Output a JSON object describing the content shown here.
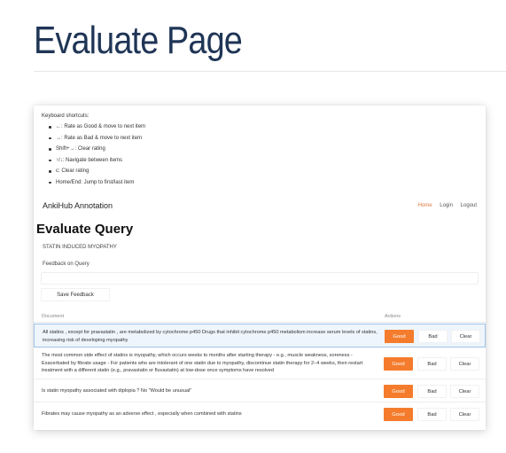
{
  "slide": {
    "title": "Evaluate Page"
  },
  "shortcuts": {
    "title": "Keyboard shortcuts:",
    "items": [
      "←: Rate as Good & move to next item",
      "→: Rate as Bad & move to next item",
      "Shift+→: Clear rating",
      "↑/↓: Navigate between items",
      "c: Clear rating",
      "Home/End: Jump to first/last item"
    ]
  },
  "nav": {
    "brand": "AnkiHub Annotation",
    "home": "Home",
    "login": "Login",
    "logout": "Logout"
  },
  "page": {
    "heading": "Evaluate Query",
    "query": "STATIN INDUCED MYOPATHY",
    "feedback_label": "Feedback on Query",
    "feedback_value": "",
    "save_label": "Save Feedback"
  },
  "table": {
    "col_document": "Document",
    "col_actions": "Actions",
    "good_label": "Good",
    "bad_label": "Bad",
    "clear_label": "Clear",
    "rows": [
      {
        "text": "All statins , except for pravastatin , are metabolized by cytochrome p450 Drugs that inhibit cytochrome p450 metabolism increase serum levels of statins, increasing risk of developing myopathy"
      },
      {
        "text": "The most common side effect of statins is myopathy, which occurs weeks to months after starting therapy - e.g., muscle weakness, soreness - Exacerbated by fibrate usage - For patients who are intolerant of one statin due to myopathy, discontinue statin therapy for 2–4 weeks, then restart treatment with a different statin (e.g., pravastatin or fluvastatin) at low-dose once symptoms have resolved"
      },
      {
        "text": "Is statin myopathy associated with diplopia ? No \"Would be unusual\""
      },
      {
        "text": "Fibrates may cause myopathy as an adverse effect , especially when combined with statins"
      }
    ]
  },
  "colors": {
    "title": "#1f3556",
    "accent": "#f47c2c",
    "active_row_bg": "#eef5fd",
    "active_row_border": "#9fc3ea"
  }
}
